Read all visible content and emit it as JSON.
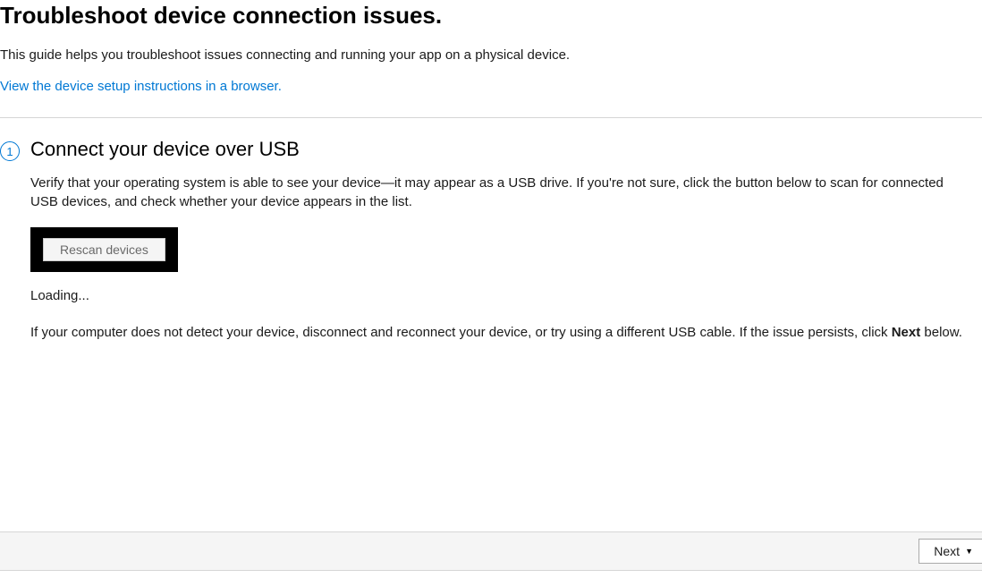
{
  "header": {
    "title": "Troubleshoot device connection issues.",
    "intro": "This guide helps you troubleshoot issues connecting and running your app on a physical device.",
    "setup_link": "View the device setup instructions in a browser."
  },
  "step": {
    "number": "1",
    "title": "Connect your device over USB",
    "description": "Verify that your operating system is able to see your device—it may appear as a USB drive. If you're not sure, click the button below to scan for connected USB devices, and check whether your device appears in the list.",
    "rescan_button_label": "Rescan devices",
    "loading_label": "Loading...",
    "note_prefix": "If your computer does not detect your device, disconnect and reconnect your device, or try using a different USB cable. If the issue persists, click ",
    "note_bold": "Next",
    "note_suffix": " below."
  },
  "footer": {
    "next_label": "Next"
  }
}
